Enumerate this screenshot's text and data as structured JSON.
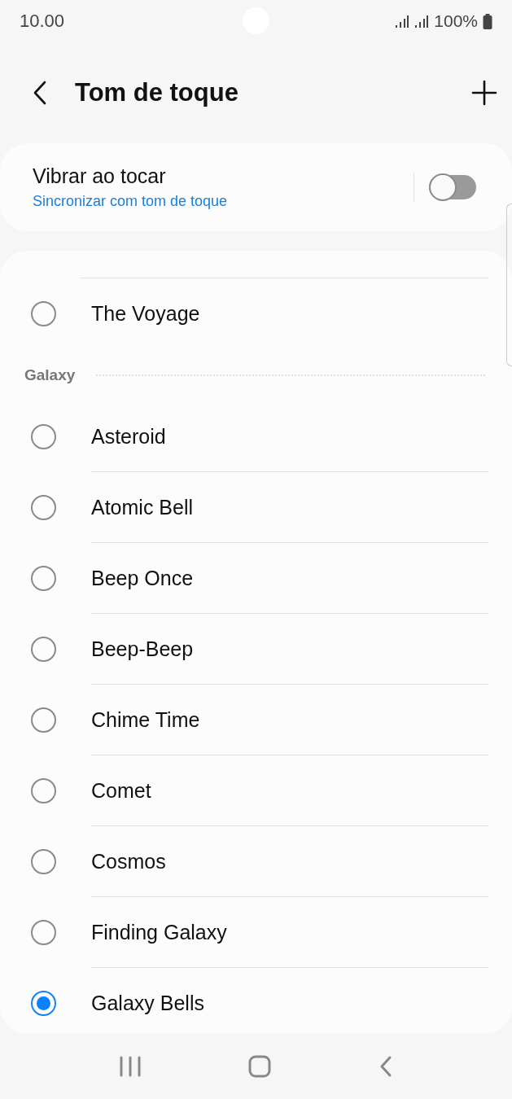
{
  "status_bar": {
    "time": "10.00",
    "battery": "100%"
  },
  "header": {
    "title": "Tom de toque"
  },
  "vibrate": {
    "title": "Vibrar ao tocar",
    "subtitle": "Sincronizar com tom de toque",
    "on": false
  },
  "sections": [
    {
      "items": [
        {
          "name": "The Voyage",
          "selected": false
        }
      ]
    },
    {
      "title": "Galaxy",
      "items": [
        {
          "name": "Asteroid",
          "selected": false
        },
        {
          "name": "Atomic Bell",
          "selected": false
        },
        {
          "name": "Beep Once",
          "selected": false
        },
        {
          "name": "Beep-Beep",
          "selected": false
        },
        {
          "name": "Chime Time",
          "selected": false
        },
        {
          "name": "Comet",
          "selected": false
        },
        {
          "name": "Cosmos",
          "selected": false
        },
        {
          "name": "Finding Galaxy",
          "selected": false
        },
        {
          "name": "Galaxy Bells",
          "selected": true
        }
      ]
    }
  ]
}
